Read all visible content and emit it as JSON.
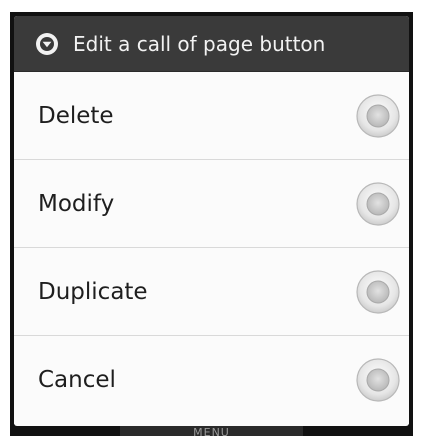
{
  "dialog": {
    "title": "Edit a call of page button",
    "title_icon": "chevron-down-circle-icon",
    "options": [
      {
        "label": "Delete",
        "selected": false
      },
      {
        "label": "Modify",
        "selected": false
      },
      {
        "label": "Duplicate",
        "selected": false
      },
      {
        "label": "Cancel",
        "selected": false
      }
    ]
  },
  "background": {
    "partial_text": "MENU"
  },
  "colors": {
    "header_bg": "#3a3a3a",
    "header_text": "#f2f2f2",
    "list_bg": "#fbfbfb",
    "divider": "#d9d9d9",
    "item_text": "#1e1e1e",
    "backdrop": "#111111"
  }
}
